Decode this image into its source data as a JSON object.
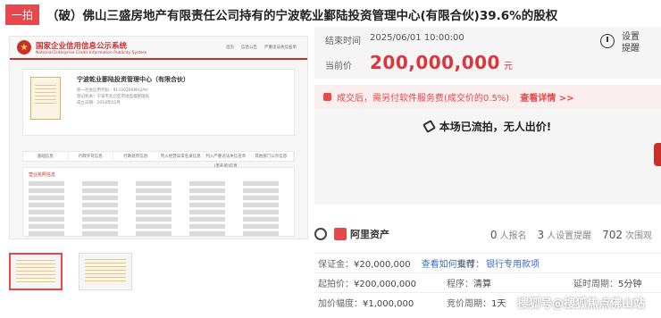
{
  "title": {
    "badge": "一拍",
    "text": "（破）佛山三盛房地产有限责任公司持有的宁波乾业鄞陆投资管理中心(有限合伙)39.6%的股权"
  },
  "gallery": {
    "gs_title_cn": "国家企业信用信息公示系统",
    "gs_title_en": "National Enterprise Credit Information Publicity System",
    "gs_nav": [
      "首页",
      "信息公告",
      "严重违法失信名单"
    ],
    "company_name": "宁波乾业鄞陆投资管理中心（有限合伙）",
    "company_lines": [
      "统一社会信用代码：91330206MA2AH",
      "登记机关：宁波市北仑区市场监督管理局",
      "成立日期：2018年05月"
    ],
    "tabs": [
      "基础信息",
      "行政许可信息",
      "行政处罚信息",
      "列入经营异常名录信息",
      "列入严重违法失信名单(黑名单)信息",
      "其他部门公示信息"
    ],
    "info_heading": "营业执照信息"
  },
  "auction": {
    "end_label": "结束时间",
    "end_value": "2025/06/01 10:00:00",
    "current_label": "当前价",
    "current_price": "200,000,000",
    "currency_unit": "元",
    "reminder_label_1": "设置",
    "reminder_label_2": "提醒",
    "notice_text": "成交后，需另付软件服务费(成交价的0.5%)",
    "notice_link": "查看详情 >>",
    "status_text": "本场已流拍，无人出价!"
  },
  "platform": {
    "name": "阿里资产",
    "signup_count": "0",
    "signup_label": "人报名",
    "reminder_count": "3",
    "reminder_label": "人设置提醒",
    "views_count": "702",
    "views_label": "次围观"
  },
  "details": {
    "deposit_label": "保证金：",
    "deposit_value": "¥20,000,000",
    "deposit_link": "查看如何支付",
    "recommend_label": "推荐：",
    "recommend_value": "银行专用款项",
    "start_label": "起拍价：",
    "start_value": "¥200,000,000",
    "procedure_label": "程序：",
    "procedure_value": "清算",
    "delay_label": "延时周期：",
    "delay_value": "5分钟",
    "increment_label": "加价幅度：",
    "increment_value": "¥1,000,000",
    "cycle_label": "竞价周期：",
    "cycle_value": "1天"
  },
  "watermark": "搜狐号@搜狐焦点佛山站",
  "colors": {
    "accent": "#e5484d",
    "price": "#d9363e",
    "link": "#3c6ec8"
  }
}
